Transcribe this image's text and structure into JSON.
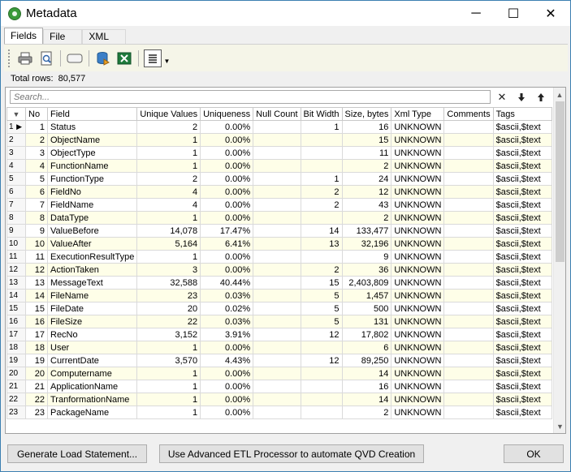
{
  "window": {
    "title": "Metadata",
    "minimize": "─",
    "maximize": "☐",
    "close": "✕"
  },
  "tabs": [
    {
      "label": "Fields",
      "active": true
    },
    {
      "label": "File",
      "active": false
    },
    {
      "label": "XML",
      "active": false
    }
  ],
  "toolbar": {
    "icons": [
      "print-icon",
      "print-preview-icon",
      "view-icon",
      "database-export-icon",
      "excel-export-icon",
      "columns-icon"
    ]
  },
  "summary": {
    "total_rows_label": "Total rows:",
    "total_rows_value": "80,577"
  },
  "search": {
    "placeholder": "Search...",
    "clear": "✕",
    "down": "🡇",
    "up": "🡅"
  },
  "grid": {
    "columns": [
      "No",
      "Field",
      "Unique Values",
      "Uniqueness",
      "Null Count",
      "Bit Width",
      "Size, bytes",
      "Xml Type",
      "Comments",
      "Tags"
    ],
    "rows": [
      [
        "1",
        "1",
        "Status",
        "2",
        "0.00%",
        "",
        "1",
        "16",
        "UNKNOWN",
        "",
        "$ascii,$text"
      ],
      [
        "2",
        "2",
        "ObjectName",
        "1",
        "0.00%",
        "",
        "",
        "15",
        "UNKNOWN",
        "",
        "$ascii,$text"
      ],
      [
        "3",
        "3",
        "ObjectType",
        "1",
        "0.00%",
        "",
        "",
        "11",
        "UNKNOWN",
        "",
        "$ascii,$text"
      ],
      [
        "4",
        "4",
        "FunctionName",
        "1",
        "0.00%",
        "",
        "",
        "2",
        "UNKNOWN",
        "",
        "$ascii,$text"
      ],
      [
        "5",
        "5",
        "FunctionType",
        "2",
        "0.00%",
        "",
        "1",
        "24",
        "UNKNOWN",
        "",
        "$ascii,$text"
      ],
      [
        "6",
        "6",
        "FieldNo",
        "4",
        "0.00%",
        "",
        "2",
        "12",
        "UNKNOWN",
        "",
        "$ascii,$text"
      ],
      [
        "7",
        "7",
        "FieldName",
        "4",
        "0.00%",
        "",
        "2",
        "43",
        "UNKNOWN",
        "",
        "$ascii,$text"
      ],
      [
        "8",
        "8",
        "DataType",
        "1",
        "0.00%",
        "",
        "",
        "2",
        "UNKNOWN",
        "",
        "$ascii,$text"
      ],
      [
        "9",
        "9",
        "ValueBefore",
        "14,078",
        "17.47%",
        "",
        "14",
        "133,477",
        "UNKNOWN",
        "",
        "$ascii,$text"
      ],
      [
        "10",
        "10",
        "ValueAfter",
        "5,164",
        "6.41%",
        "",
        "13",
        "32,196",
        "UNKNOWN",
        "",
        "$ascii,$text"
      ],
      [
        "11",
        "11",
        "ExecutionResultType",
        "1",
        "0.00%",
        "",
        "",
        "9",
        "UNKNOWN",
        "",
        "$ascii,$text"
      ],
      [
        "12",
        "12",
        "ActionTaken",
        "3",
        "0.00%",
        "",
        "2",
        "36",
        "UNKNOWN",
        "",
        "$ascii,$text"
      ],
      [
        "13",
        "13",
        "MessageText",
        "32,588",
        "40.44%",
        "",
        "15",
        "2,403,809",
        "UNKNOWN",
        "",
        "$ascii,$text"
      ],
      [
        "14",
        "14",
        "FileName",
        "23",
        "0.03%",
        "",
        "5",
        "1,457",
        "UNKNOWN",
        "",
        "$ascii,$text"
      ],
      [
        "15",
        "15",
        "FileDate",
        "20",
        "0.02%",
        "",
        "5",
        "500",
        "UNKNOWN",
        "",
        "$ascii,$text"
      ],
      [
        "16",
        "16",
        "FileSize",
        "22",
        "0.03%",
        "",
        "5",
        "131",
        "UNKNOWN",
        "",
        "$ascii,$text"
      ],
      [
        "17",
        "17",
        "RecNo",
        "3,152",
        "3.91%",
        "",
        "12",
        "17,802",
        "UNKNOWN",
        "",
        "$ascii,$text"
      ],
      [
        "18",
        "18",
        "User",
        "1",
        "0.00%",
        "",
        "",
        "6",
        "UNKNOWN",
        "",
        "$ascii,$text"
      ],
      [
        "19",
        "19",
        "CurrentDate",
        "3,570",
        "4.43%",
        "",
        "12",
        "89,250",
        "UNKNOWN",
        "",
        "$ascii,$text"
      ],
      [
        "20",
        "20",
        "Computername",
        "1",
        "0.00%",
        "",
        "",
        "14",
        "UNKNOWN",
        "",
        "$ascii,$text"
      ],
      [
        "21",
        "21",
        "ApplicationName",
        "1",
        "0.00%",
        "",
        "",
        "16",
        "UNKNOWN",
        "",
        "$ascii,$text"
      ],
      [
        "22",
        "22",
        "TranformationName",
        "1",
        "0.00%",
        "",
        "",
        "14",
        "UNKNOWN",
        "",
        "$ascii,$text"
      ],
      [
        "23",
        "23",
        "PackageName",
        "1",
        "0.00%",
        "",
        "",
        "2",
        "UNKNOWN",
        "",
        "$ascii,$text"
      ]
    ]
  },
  "buttons": {
    "generate": "Generate Load Statement...",
    "etl": "Use Advanced ETL Processor to automate QVD Creation",
    "ok": "OK"
  }
}
